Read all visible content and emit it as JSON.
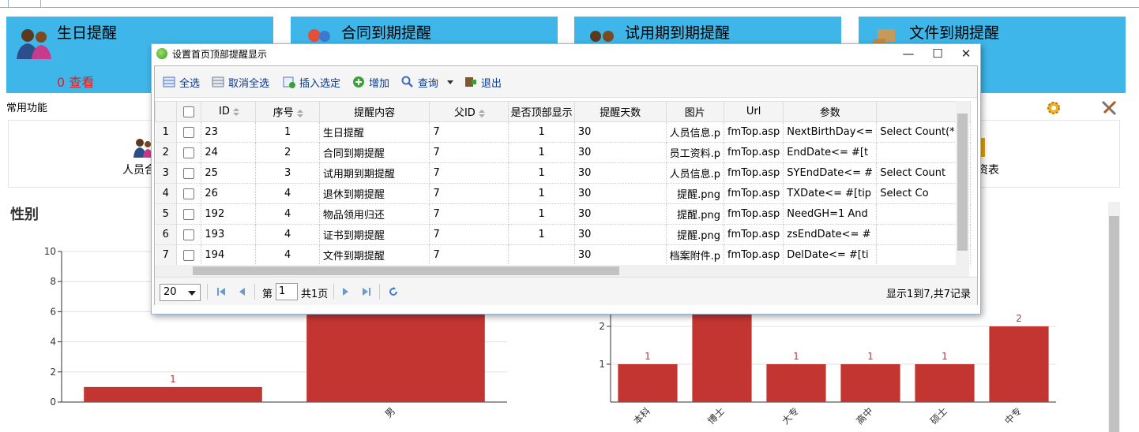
{
  "cards": [
    {
      "title": "生日提醒",
      "count": "0",
      "action": "查看"
    },
    {
      "title": "合同到期提醒"
    },
    {
      "title": "试用期到期提醒"
    },
    {
      "title": "文件到期提醒"
    }
  ],
  "section_label": "常用功能",
  "func_items": [
    "人员合",
    "资表"
  ],
  "chart_left_title": "性别",
  "dialog": {
    "title": "设置首页顶部提醒显示",
    "window_buttons": [
      "—",
      "☐",
      "✕"
    ],
    "toolbar": [
      "全选",
      "取消全选",
      "插入选定",
      "增加",
      "查询",
      "退出"
    ],
    "columns": [
      "ID",
      "序号",
      "提醒内容",
      "父ID",
      "是否顶部显示",
      "提醒天数",
      "图片",
      "Url",
      "参数",
      ""
    ],
    "rows": [
      {
        "rn": "1",
        "id": "23",
        "seq": "1",
        "content": "生日提醒",
        "pid": "7",
        "show": "1",
        "days": "30",
        "img": "人员信息.p",
        "url": "fmTop.asp",
        "param": "NextBirthDay<=",
        "extra": "Select Count(*"
      },
      {
        "rn": "2",
        "id": "24",
        "seq": "2",
        "content": "合同到期提醒",
        "pid": "7",
        "show": "1",
        "days": "30",
        "img": "员工资料.p",
        "url": "fmTop.asp",
        "param": "EndDate<= #[t",
        "extra": ""
      },
      {
        "rn": "3",
        "id": "25",
        "seq": "3",
        "content": "试用期到期提醒",
        "pid": "7",
        "show": "1",
        "days": "30",
        "img": "人员信息.p",
        "url": "fmTop.asp",
        "param": "SYEndDate<= #",
        "extra": "Select Count"
      },
      {
        "rn": "4",
        "id": "26",
        "seq": "4",
        "content": "退休到期提醒",
        "pid": "7",
        "show": "1",
        "days": "30",
        "img": "提醒.png",
        "url": "fmTop.asp",
        "param": "TXDate<= #[tip",
        "extra": "Select Co"
      },
      {
        "rn": "5",
        "id": "192",
        "seq": "4",
        "content": "物品领用归还",
        "pid": "7",
        "show": "1",
        "days": "30",
        "img": "提醒.png",
        "url": "fmTop.asp",
        "param": "NeedGH=1 And",
        "extra": ""
      },
      {
        "rn": "6",
        "id": "193",
        "seq": "4",
        "content": "证书到期提醒",
        "pid": "7",
        "show": "1",
        "days": "30",
        "img": "提醒.png",
        "url": "fmTop.asp",
        "param": "zsEndDate<= #",
        "extra": ""
      },
      {
        "rn": "7",
        "id": "194",
        "seq": "4",
        "content": "文件到期提醒",
        "pid": "7",
        "show": "",
        "days": "30",
        "img": "档案附件.p",
        "url": "fmTop.asp",
        "param": "DelDate<= #[ti",
        "extra": ""
      }
    ],
    "pager": {
      "page_size": "20",
      "page_prefix": "第",
      "page": "1",
      "page_total": "共1页",
      "info": "显示1到7,共7记录"
    }
  },
  "colors": {
    "card_bg": "#3eb6e9",
    "bar": "#c23531",
    "link": "#0b3a91",
    "alert": "#e02020"
  },
  "chart_data": [
    {
      "type": "bar",
      "title": "性别",
      "categories": [
        "",
        "男"
      ],
      "values": [
        1,
        6
      ],
      "ylim": [
        0,
        10
      ],
      "yticks": [
        "0",
        "2",
        "4",
        "6",
        "8",
        "10"
      ],
      "data_labels": [
        "1"
      ]
    },
    {
      "type": "bar",
      "title": "",
      "categories": [
        "本科",
        "博士",
        "大专",
        "高中",
        "硕士",
        "中专"
      ],
      "values": [
        1,
        3,
        1,
        1,
        1,
        2
      ],
      "yticks": [
        "1",
        "2"
      ],
      "data_labels": [
        "1",
        "",
        "1",
        "1",
        "1",
        "2"
      ]
    }
  ]
}
